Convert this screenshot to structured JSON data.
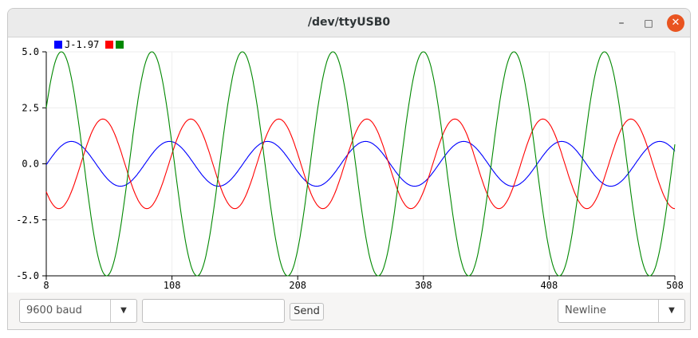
{
  "window": {
    "title": "/dev/ttyUSB0",
    "minimize_glyph": "–",
    "maximize_glyph": "□",
    "close_glyph": "✕",
    "close_color": "#e95420"
  },
  "controls": {
    "baud_value": "9600 baud",
    "send_label": "Send",
    "line_ending_value": "Newline",
    "message_value": ""
  },
  "legend": {
    "first_label": "J-1.97"
  },
  "chart_data": {
    "type": "line",
    "x_ticks": [
      8,
      108,
      208,
      308,
      408,
      508
    ],
    "y_ticks": [
      5.0,
      2.5,
      0.0,
      -2.5,
      -5.0
    ],
    "y_tick_labels": [
      "5.0",
      "2.5",
      "0.0",
      "-2.5",
      "-5.0"
    ],
    "xlim": [
      8,
      508
    ],
    "ylim": [
      -5.0,
      5.0
    ],
    "grid": true,
    "legend_position": "top-left",
    "series": [
      {
        "color": "#0000ff",
        "amplitude": 1.0,
        "period": 78,
        "x_at_peak": 28
      },
      {
        "color": "#ff0000",
        "amplitude": 2.0,
        "period": 70,
        "x_at_peak": 53
      },
      {
        "color": "#008800",
        "amplitude": 5.0,
        "period": 72,
        "x_at_peak": 20
      }
    ]
  }
}
